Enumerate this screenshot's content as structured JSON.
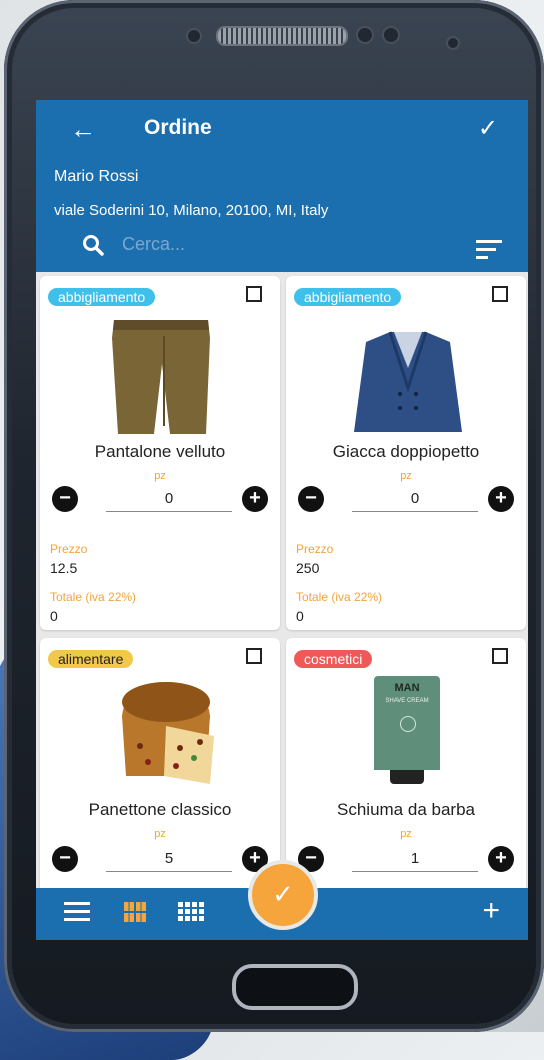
{
  "app": {
    "title": "Ordine",
    "customer_name": "Mario Rossi",
    "customer_address": "viale Soderini 10, Milano, 20100, MI, Italy",
    "search_placeholder": "Cerca..."
  },
  "colors": {
    "primary": "#1c6fae",
    "accent": "#f5a53b",
    "tag_abbigliamento": "#3fc0ea",
    "tag_alimentare": "#f2c84b",
    "tag_cosmetici": "#ee5a57"
  },
  "labels": {
    "unit": "pz",
    "price": "Prezzo",
    "total": "Totale (iva 22%)"
  },
  "products": [
    {
      "category": "abbigliamento",
      "name": "Pantalone velluto",
      "qty": "0",
      "price": "12.5",
      "total": "0"
    },
    {
      "category": "abbigliamento",
      "name": "Giacca doppiopetto",
      "qty": "0",
      "price": "250",
      "total": "0"
    },
    {
      "category": "alimentare",
      "name": "Panettone classico",
      "qty": "5"
    },
    {
      "category": "cosmetici",
      "name": "Schiuma da barba",
      "qty": "1",
      "brand": "MAN",
      "brand_sub": "SHAVE CREAM"
    }
  ],
  "icons": {
    "back": "arrow-left-icon",
    "confirm": "check-icon",
    "search": "search-icon",
    "filter": "sort-icon",
    "expand": "fullscreen-icon",
    "minus": "minus-circle-icon",
    "plus": "plus-circle-icon",
    "list": "list-icon",
    "grid2": "grid-icon",
    "grid3": "grid-compact-icon",
    "add": "add-icon"
  }
}
